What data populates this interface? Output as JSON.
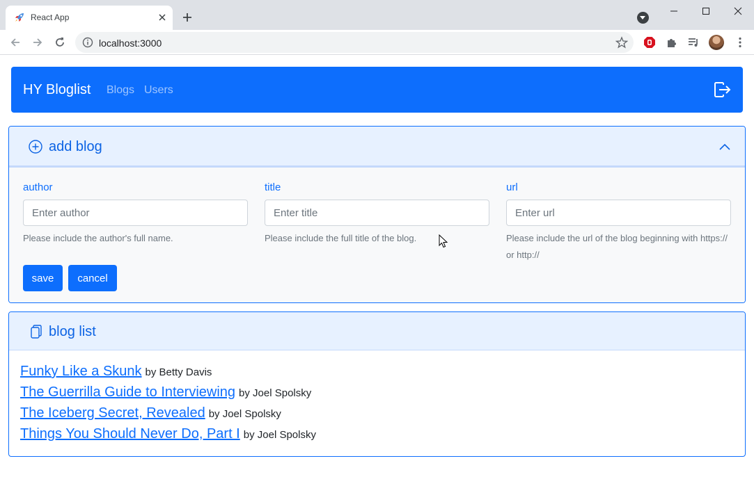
{
  "browser": {
    "tab_title": "React App",
    "url": "localhost:3000"
  },
  "navbar": {
    "brand": "HY Bloglist",
    "links": [
      "Blogs",
      "Users"
    ]
  },
  "add_blog": {
    "header": "add blog",
    "fields": {
      "author": {
        "label": "author",
        "placeholder": "Enter author",
        "value": "",
        "help": "Please include the author's full name."
      },
      "title": {
        "label": "title",
        "placeholder": "Enter title",
        "value": "",
        "help": "Please include the full title of the blog."
      },
      "url": {
        "label": "url",
        "placeholder": "Enter url",
        "value": "",
        "help": "Please include the url of the blog beginning with https:// or http://"
      }
    },
    "save_label": "save",
    "cancel_label": "cancel"
  },
  "blog_list": {
    "header": "blog list",
    "items": [
      {
        "title": "Funky Like a Skunk",
        "by": "by Betty Davis"
      },
      {
        "title": "The Guerrilla Guide to Interviewing",
        "by": "by Joel Spolsky"
      },
      {
        "title": "The Iceberg Secret, Revealed",
        "by": "by Joel Spolsky"
      },
      {
        "title": "Things You Should Never Do, Part I",
        "by": "by Joel Spolsky"
      }
    ]
  },
  "colors": {
    "primary": "#0d6efd",
    "accordion_header_bg": "#e7f1ff",
    "accordion_text": "#0c63e4",
    "body_bg": "#f8f9fa"
  }
}
